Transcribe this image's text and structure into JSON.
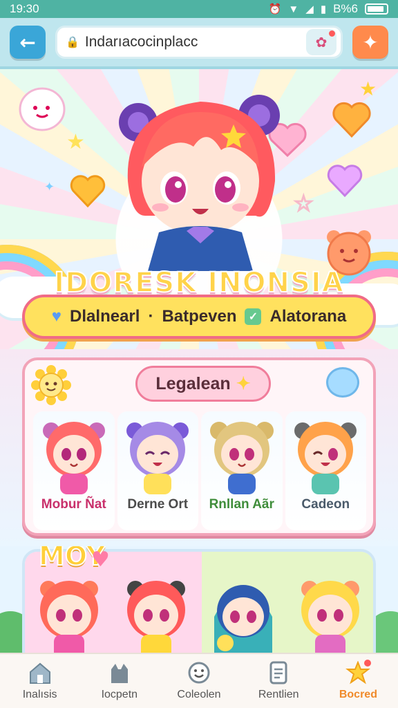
{
  "status": {
    "time": "19:30",
    "network": "B%6",
    "icons": [
      "alarm-icon",
      "wifi-icon",
      "signal-icon",
      "sim-icon",
      "battery-icon"
    ]
  },
  "toolbar": {
    "url_text": "Indarıacocinplacc",
    "back_icon": "back-arrow-icon",
    "chat_icon": "chat-bubble-icon",
    "fav_icon": "badge-icon"
  },
  "hero": {
    "title": "IDORESK INONSIA",
    "pill": [
      "Dlalnearl",
      "·",
      "Batpeven",
      "Alatorana"
    ]
  },
  "section_characters": {
    "label": "Legalean",
    "items": [
      {
        "name": "Mobur Ñat",
        "color": "#c9306b"
      },
      {
        "name": "Derne Ort",
        "color": "#4b4b4b"
      },
      {
        "name": "Rnllan Aãr",
        "color": "#3f8d3a"
      },
      {
        "name": "Cadeon",
        "color": "#4a5a6a"
      }
    ]
  },
  "section_more": {
    "title": "MOY"
  },
  "nav": {
    "items": [
      {
        "label": "Inalısis",
        "icon": "home-icon"
      },
      {
        "label": "Iocpetn",
        "icon": "cat-icon"
      },
      {
        "label": "Coleolen",
        "icon": "smile-icon"
      },
      {
        "label": "Rentlien",
        "icon": "document-icon"
      },
      {
        "label": "Bocred",
        "icon": "star-icon",
        "active": true
      }
    ]
  },
  "colors": {
    "accent": "#f08a2a",
    "status_bar": "#4fb3a3",
    "toolbar": "#bfe6ee"
  }
}
